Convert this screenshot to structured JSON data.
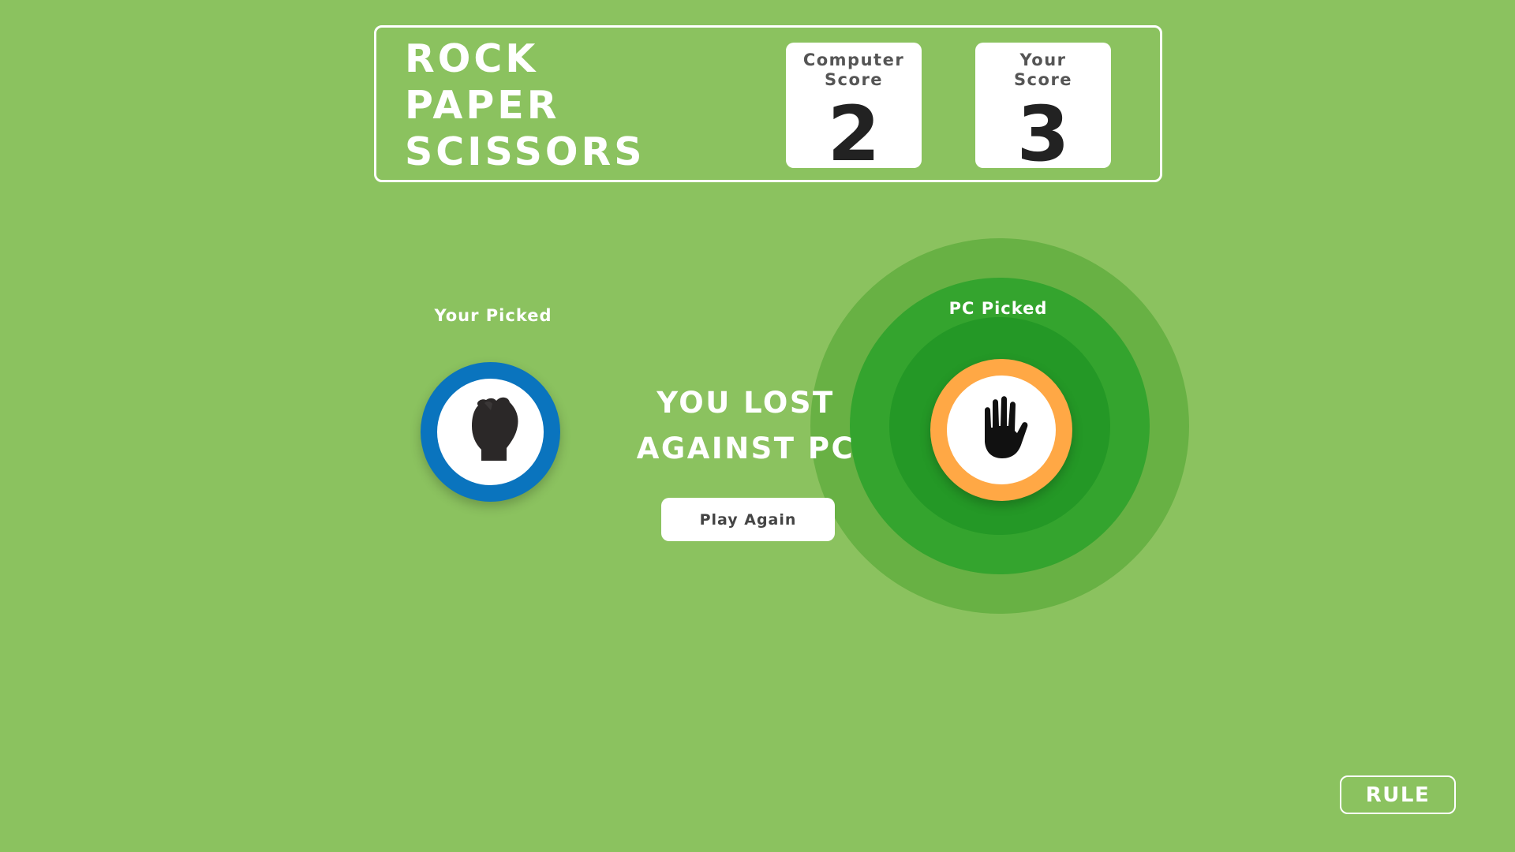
{
  "header": {
    "title_lines": [
      "ROCK",
      "PAPER",
      "SCISSORS"
    ],
    "computer_score": {
      "label_lines": [
        "Computer",
        "Score"
      ],
      "value": "2"
    },
    "your_score": {
      "label_lines": [
        "Your",
        "Score"
      ],
      "value": "3"
    }
  },
  "player_pick": {
    "label": "Your Picked",
    "choice": "rock",
    "icon": "rock-fist-icon",
    "ring_color": "#0a74be"
  },
  "pc_pick": {
    "label": "PC Picked",
    "choice": "paper",
    "icon": "paper-hand-icon",
    "ring_color": "#ffa845",
    "winner": true
  },
  "result": {
    "lines": [
      "YOU LOST",
      "AGAINST PC"
    ],
    "play_again_label": "Play Again"
  },
  "rule_button_label": "RULE",
  "colors": {
    "background": "#8bc25f",
    "winner_ring_outer": "#68b144",
    "winner_ring_mid": "#34a42e",
    "winner_ring_inner": "#249826"
  }
}
